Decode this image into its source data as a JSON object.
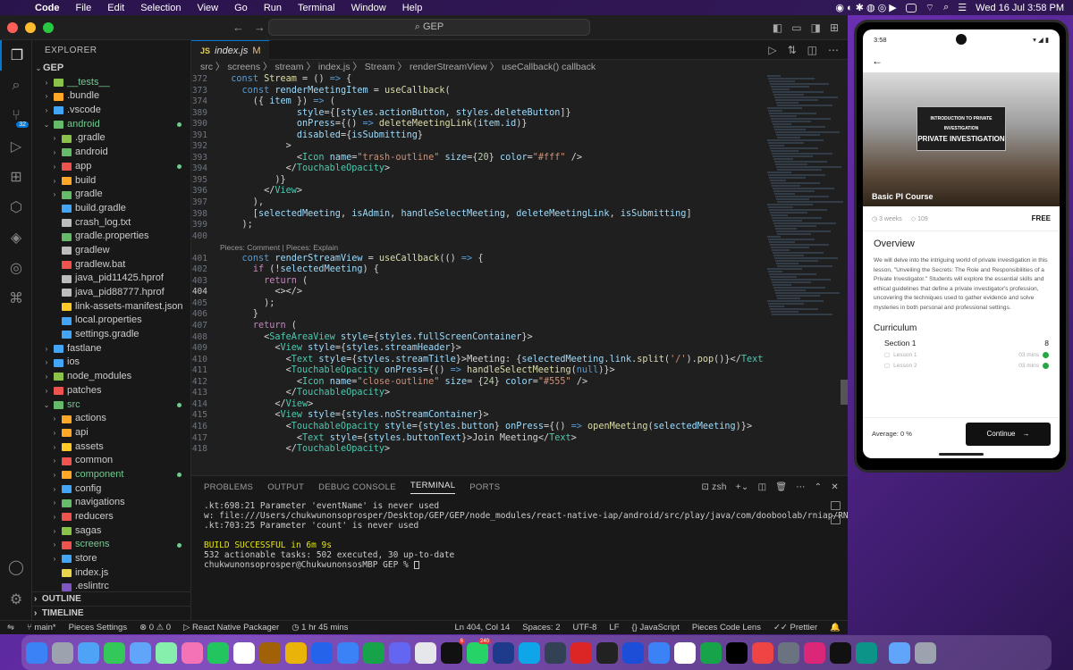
{
  "menubar": {
    "items": [
      "Code",
      "File",
      "Edit",
      "Selection",
      "View",
      "Go",
      "Run",
      "Terminal",
      "Window",
      "Help"
    ],
    "datetime": "Wed 16 Jul  3:58 PM"
  },
  "titlebar": {
    "search": "GEP"
  },
  "activity": {
    "scm_badge": "32"
  },
  "explorer": {
    "header": "EXPLORER",
    "root": "GEP",
    "items": [
      {
        "label": "__tests__",
        "color": "#73c991",
        "dot": false
      },
      {
        "label": ".bundle",
        "color": "#cccccc"
      },
      {
        "label": ".vscode",
        "color": "#cccccc"
      },
      {
        "label": "android",
        "color": "#73c991",
        "dot": true
      },
      {
        "label": ".gradle",
        "color": "#cccccc"
      },
      {
        "label": "android",
        "color": "#cccccc"
      },
      {
        "label": "app",
        "color": "#cccccc",
        "dot": true
      },
      {
        "label": "build",
        "color": "#cccccc"
      },
      {
        "label": "gradle",
        "color": "#cccccc"
      },
      {
        "label": "build.gradle",
        "color": "#cccccc"
      },
      {
        "label": "crash_log.txt",
        "color": "#cccccc"
      },
      {
        "label": "gradle.properties",
        "color": "#cccccc"
      },
      {
        "label": "gradlew",
        "color": "#cccccc"
      },
      {
        "label": "gradlew.bat",
        "color": "#cccccc"
      },
      {
        "label": "java_pid11425.hprof",
        "color": "#cccccc"
      },
      {
        "label": "java_pid88777.hprof",
        "color": "#cccccc"
      },
      {
        "label": "link-assets-manifest.json",
        "color": "#cccccc"
      },
      {
        "label": "local.properties",
        "color": "#cccccc"
      },
      {
        "label": "settings.gradle",
        "color": "#cccccc"
      },
      {
        "label": "fastlane",
        "color": "#cccccc"
      },
      {
        "label": "ios",
        "color": "#cccccc"
      },
      {
        "label": "node_modules",
        "color": "#cccccc"
      },
      {
        "label": "patches",
        "color": "#cccccc"
      },
      {
        "label": "src",
        "color": "#73c991",
        "dot": true
      },
      {
        "label": "actions",
        "color": "#cccccc"
      },
      {
        "label": "api",
        "color": "#cccccc"
      },
      {
        "label": "assets",
        "color": "#cccccc"
      },
      {
        "label": "common",
        "color": "#cccccc"
      },
      {
        "label": "component",
        "color": "#73c991",
        "dot": true
      },
      {
        "label": "config",
        "color": "#cccccc"
      },
      {
        "label": "navigations",
        "color": "#cccccc"
      },
      {
        "label": "reducers",
        "color": "#cccccc"
      },
      {
        "label": "sagas",
        "color": "#cccccc"
      },
      {
        "label": "screens",
        "color": "#73c991",
        "dot": true
      },
      {
        "label": "store",
        "color": "#cccccc"
      },
      {
        "label": "index.js",
        "color": "#cccccc"
      },
      {
        "label": ".eslintrc",
        "color": "#cccccc"
      }
    ],
    "outline": "OUTLINE",
    "timeline": "TIMELINE"
  },
  "editor": {
    "tab": {
      "name": "index.js",
      "modified": "M"
    },
    "breadcrumb": "src 〉 screens 〉 stream 〉 index.js 〉 Stream 〉 renderStreamView 〉 useCallback() callback",
    "lens": "Pieces: Comment | Pieces: Explain"
  },
  "panel": {
    "tabs": [
      "PROBLEMS",
      "OUTPUT",
      "DEBUG CONSOLE",
      "TERMINAL",
      "PORTS"
    ],
    "shell": "zsh",
    "terminal": [
      ".kt:698:21 Parameter 'eventName' is never used",
      "w: file:///Users/chukwunonsoprosper/Desktop/GEP/GEP/node_modules/react-native-iap/android/src/play/java/com/dooboolab/rniap/RNIapModule",
      ".kt:703:25 Parameter 'count' is never used",
      "",
      "BUILD SUCCESSFUL in 6m 9s",
      "532 actionable tasks: 502 executed, 30 up-to-date",
      "chukwunonsoprosper@ChukwunonsosMBP GEP % "
    ]
  },
  "status": {
    "branch": "main*",
    "pieces": "Pieces Settings",
    "errors": "0",
    "warnings": "0",
    "packager": "React Native Packager",
    "time": "1 hr 45 mins",
    "position": "Ln 404, Col 14",
    "spaces": "Spaces: 2",
    "encoding": "UTF-8",
    "eol": "LF",
    "language": "JavaScript",
    "lens": "Pieces Code Lens",
    "prettier": "Prettier"
  },
  "phone": {
    "time": "3:58",
    "hero_text": "INTRODUCTION TO PRIVATE INVESTIGATION",
    "hero_title": "PRIVATE INVESTIGATION",
    "course_title": "Basic PI Course",
    "duration": "3 weeks",
    "points": "109",
    "price": "FREE",
    "overview_title": "Overview",
    "overview": "We will delve into the intriguing world of private investigation in this lesson, \"Unveiling the Secrets: The Role and Responsibilities of a Private Investigator.\" Students will explore the essential skills and ethical guidelines that define a private investigator's profession, uncovering the techniques used to gather evidence and solve mysteries in both personal and professional settings.",
    "curriculum_title": "Curriculum",
    "section": "Section 1",
    "section_count": "8",
    "lessons": [
      {
        "title": "Lesson 1",
        "dur": "03 mins"
      },
      {
        "title": "Lesson 2",
        "dur": "03 mins"
      }
    ],
    "average": "Average: 0 %",
    "continue": "Continue"
  },
  "dock_badges": {
    "x": "6",
    "whatsapp": "240"
  }
}
